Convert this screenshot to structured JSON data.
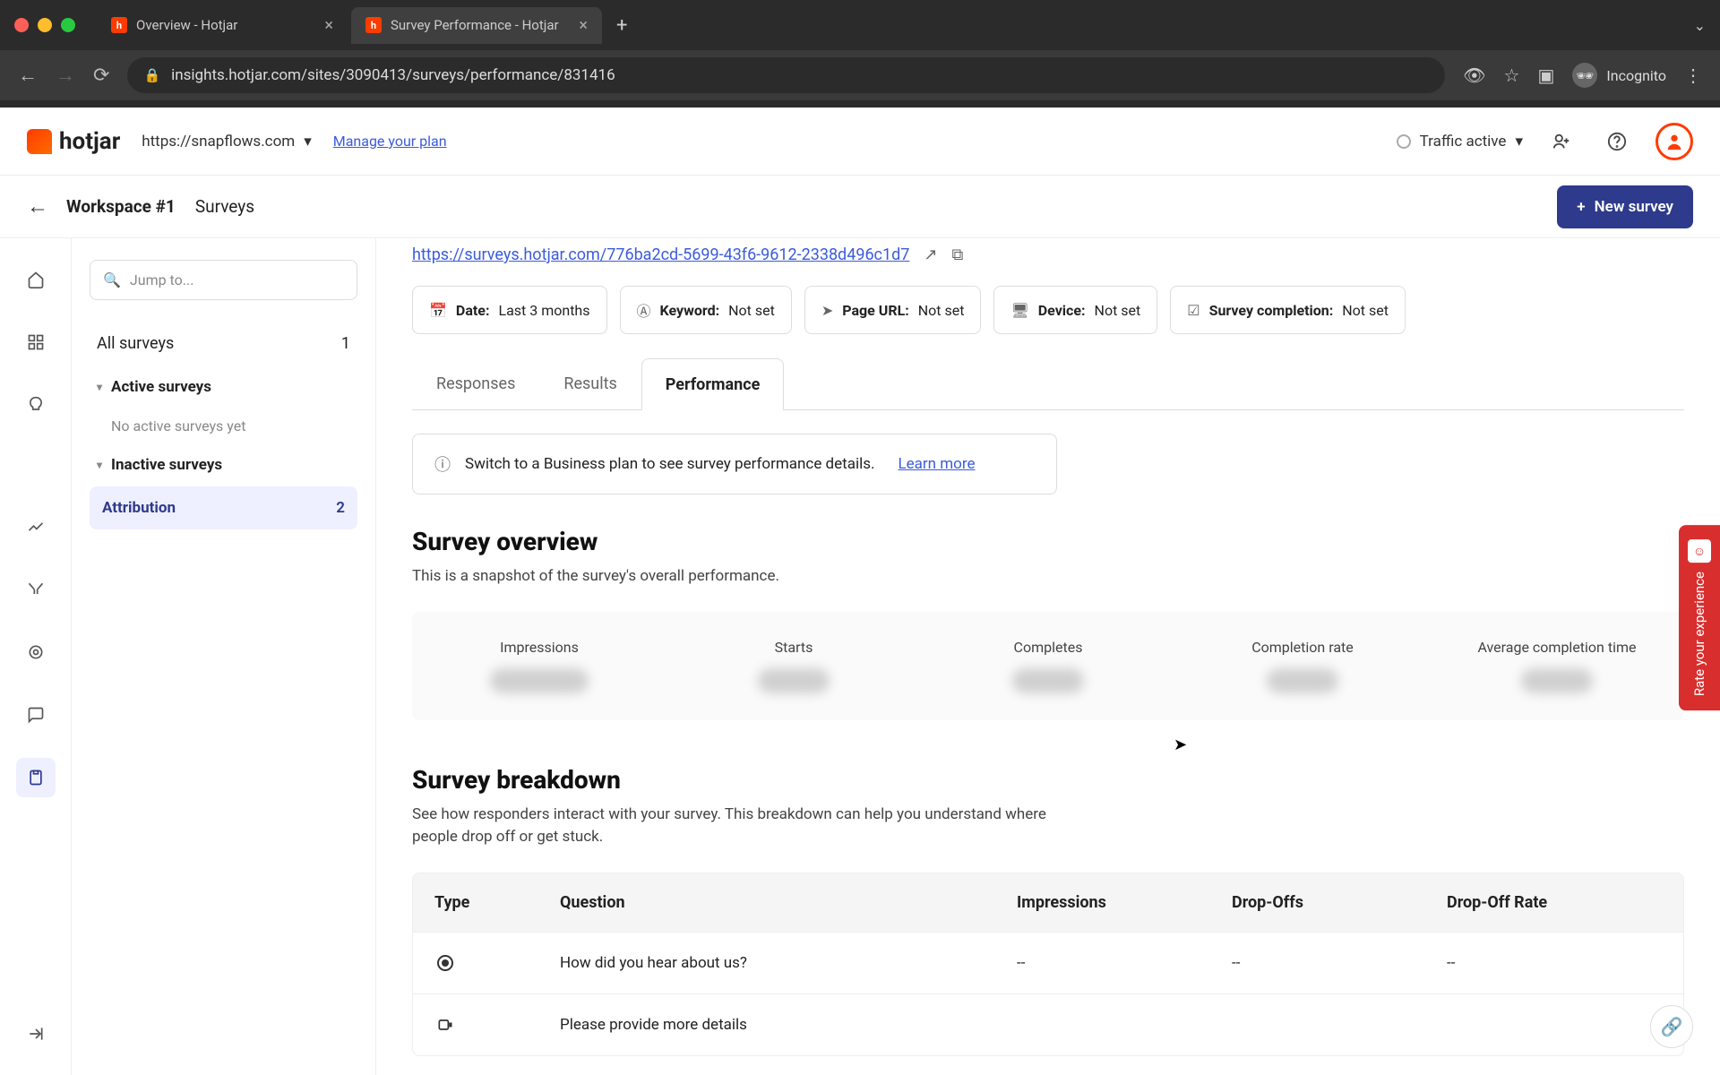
{
  "browser": {
    "tabs": [
      {
        "title": "Overview - Hotjar",
        "active": false
      },
      {
        "title": "Survey Performance - Hotjar",
        "active": true
      }
    ],
    "url": "insights.hotjar.com/sites/3090413/surveys/performance/831416",
    "incognito_label": "Incognito"
  },
  "topbar": {
    "logo_text": "hotjar",
    "site": "https://snapflows.com",
    "manage_plan": "Manage your plan",
    "traffic_status": "Traffic active"
  },
  "subheader": {
    "workspace": "Workspace #1",
    "section": "Surveys",
    "new_button": "New survey"
  },
  "sidebar": {
    "jump_placeholder": "Jump to...",
    "all_label": "All surveys",
    "all_count": "1",
    "active_group": "Active surveys",
    "active_empty": "No active surveys yet",
    "inactive_group": "Inactive surveys",
    "inactive_items": [
      {
        "name": "Attribution",
        "count": "2"
      }
    ]
  },
  "content": {
    "survey_url": "https://surveys.hotjar.com/776ba2cd-5699-43f6-9612-2338d496c1d7",
    "filters": [
      {
        "icon": "calendar",
        "label": "Date:",
        "value": "Last 3 months"
      },
      {
        "icon": "keyword",
        "label": "Keyword:",
        "value": "Not set"
      },
      {
        "icon": "pageurl",
        "label": "Page URL:",
        "value": "Not set"
      },
      {
        "icon": "device",
        "label": "Device:",
        "value": "Not set"
      },
      {
        "icon": "completion",
        "label": "Survey completion:",
        "value": "Not set"
      }
    ],
    "tabs": [
      {
        "label": "Responses",
        "active": false
      },
      {
        "label": "Results",
        "active": false
      },
      {
        "label": "Performance",
        "active": true
      }
    ],
    "notice_text": "Switch to a Business plan to see survey performance details.",
    "notice_link": "Learn more",
    "overview_title": "Survey overview",
    "overview_sub": "This is a snapshot of the survey's overall performance.",
    "metrics": [
      {
        "label": "Impressions"
      },
      {
        "label": "Starts"
      },
      {
        "label": "Completes"
      },
      {
        "label": "Completion rate"
      },
      {
        "label": "Average completion time"
      }
    ],
    "breakdown_title": "Survey breakdown",
    "breakdown_sub": "See how responders interact with your survey. This breakdown can help you understand where people drop off or get stuck.",
    "table": {
      "headers": [
        "Type",
        "Question",
        "Impressions",
        "Drop-Offs",
        "Drop-Off Rate"
      ],
      "rows": [
        {
          "type": "radio",
          "question": "How did you hear about us?",
          "impressions": "--",
          "dropoffs": "--",
          "rate": "--",
          "blurred": false
        },
        {
          "type": "text",
          "question": "Please provide more details",
          "impressions": "",
          "dropoffs": "",
          "rate": "",
          "blurred": true
        }
      ]
    },
    "rate_tab": "Rate your experience"
  }
}
